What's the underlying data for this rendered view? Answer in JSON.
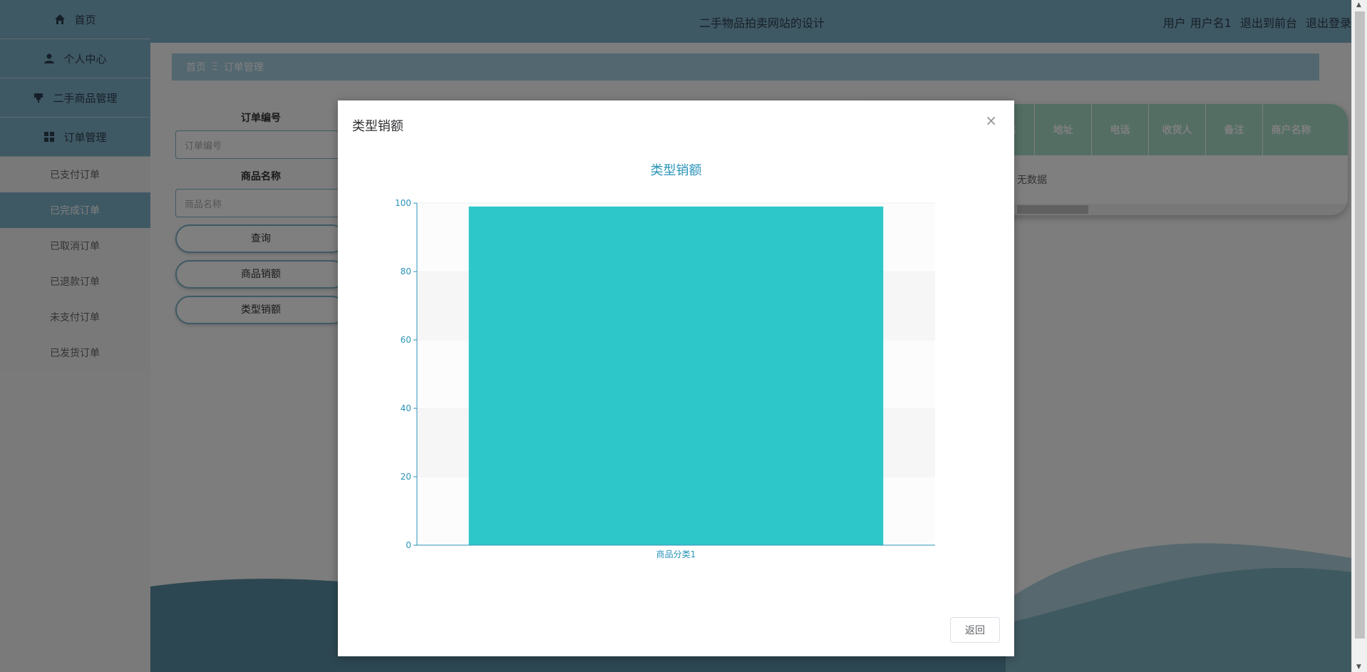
{
  "sidebar": {
    "home": "首页",
    "profile": "个人中心",
    "goods_mgmt": "二手商品管理",
    "order_mgmt": "订单管理",
    "sub_items": [
      "已支付订单",
      "已完成订单",
      "已取消订单",
      "已退款订单",
      "未支付订单",
      "已发货订单"
    ]
  },
  "header": {
    "site_title": "二手物品拍卖网站的设计",
    "user_role": "用户",
    "user_name": "用户名1",
    "to_frontend": "退出到前台",
    "logout": "退出登录"
  },
  "breadcrumb": {
    "home": "首页",
    "sep": "Ξ",
    "current": "订单管理"
  },
  "search": {
    "order_no_label": "订单编号",
    "order_no_placeholder": "订单编号",
    "goods_name_label": "商品名称",
    "goods_name_placeholder": "商品名称",
    "query_button": "查询",
    "goods_sales_button": "商品销额",
    "type_sales_button": "类型销额"
  },
  "table": {
    "columns": [
      "状态",
      "地址",
      "电话",
      "收货人",
      "备注",
      "商户名称"
    ],
    "empty_text": "无数据"
  },
  "modal": {
    "title": "类型销额",
    "close_glyph": "×",
    "back_button": "返回"
  },
  "colors": {
    "accent": "#7fb3c8",
    "bar": "#2ec7c9",
    "axis": "#2a93b8"
  },
  "chart_data": {
    "type": "bar",
    "title": "类型销额",
    "categories": [
      "商品分类1"
    ],
    "values": [
      99
    ],
    "ylim": [
      0,
      100
    ],
    "yticks": [
      0,
      20,
      40,
      60,
      80,
      100
    ],
    "xlabel": "",
    "ylabel": "",
    "grid": true
  }
}
